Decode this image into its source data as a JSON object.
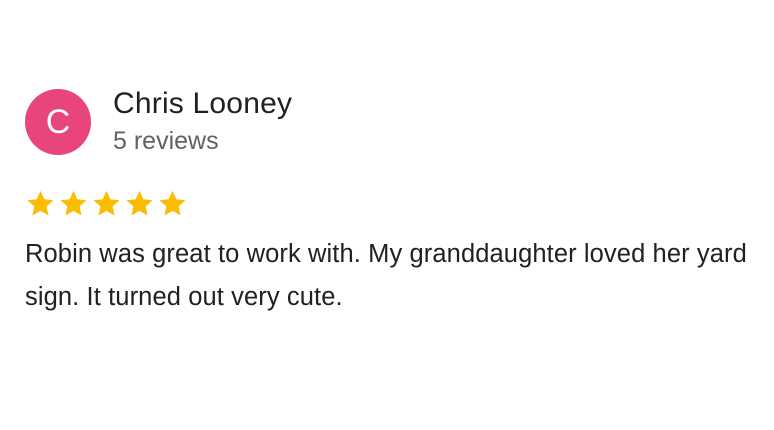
{
  "reviewer": {
    "initial": "C",
    "name": "Chris Looney",
    "review_count": "5 reviews",
    "avatar_color": "#e8457c"
  },
  "rating": {
    "stars": 5,
    "max": 5,
    "star_icon": "star-icon",
    "star_color": "#fbbc04"
  },
  "review": {
    "text": "Robin was great to work with. My granddaughter loved her yard sign. It turned out very cute."
  }
}
